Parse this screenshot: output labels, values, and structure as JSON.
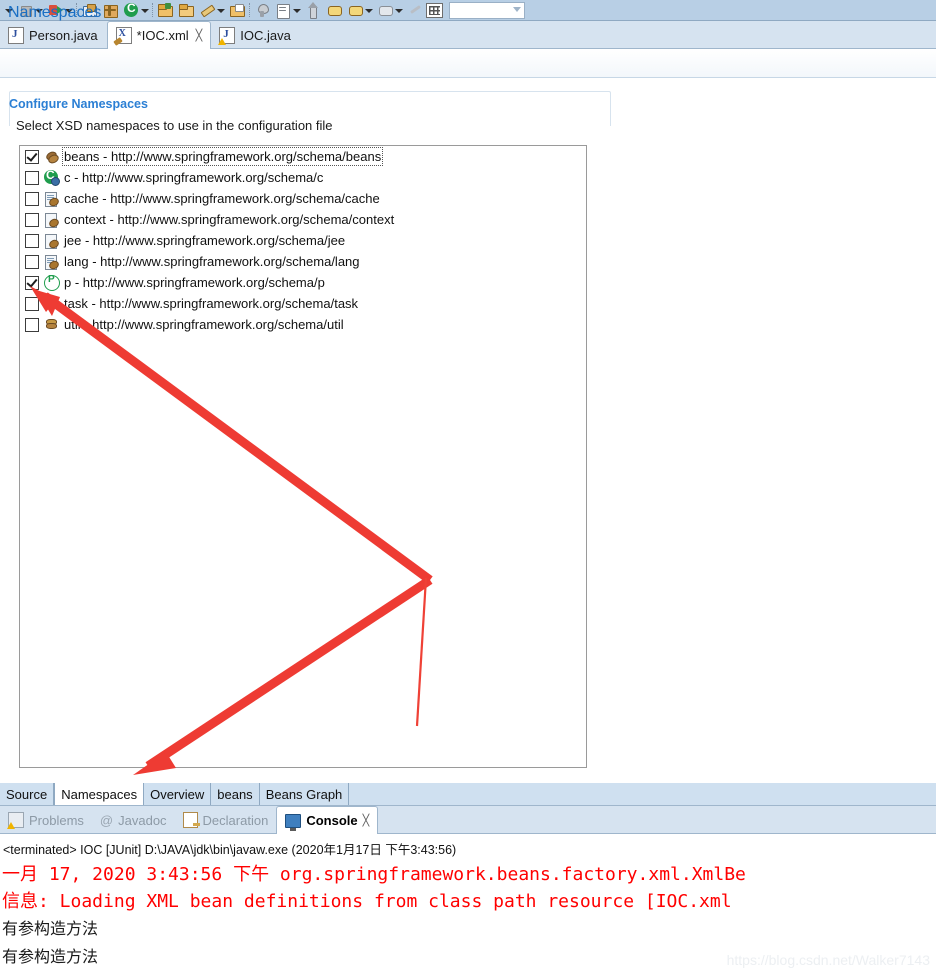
{
  "toolbar": {
    "icons": [
      {
        "name": "debug-dropdown-icon"
      },
      {
        "name": "stop-icon"
      },
      {
        "name": "run-icon"
      },
      {
        "name": "open-type-icon"
      },
      {
        "name": "package-icon"
      },
      {
        "name": "coverage-icon"
      },
      {
        "name": "new-folder-icon"
      },
      {
        "name": "open-folder-icon"
      },
      {
        "name": "pencil-icon"
      },
      {
        "name": "export-icon"
      },
      {
        "name": "search-icon"
      },
      {
        "name": "task-icon"
      },
      {
        "name": "next-annotation-icon"
      },
      {
        "name": "previous-edit-icon"
      },
      {
        "name": "bookmark-icon"
      },
      {
        "name": "back-icon"
      },
      {
        "name": "perspective-icon"
      }
    ],
    "combo_value": ""
  },
  "editor_tabs": [
    {
      "label": "Person.java",
      "icon": "java-file-icon",
      "active": false,
      "dirty": false,
      "closable": false
    },
    {
      "label": "*IOC.xml",
      "icon": "xml-file-icon",
      "active": true,
      "dirty": true,
      "closable": true,
      "close_glyph": "╳"
    },
    {
      "label": "IOC.java",
      "icon": "java-warning-file-icon",
      "active": false,
      "dirty": false,
      "closable": false
    }
  ],
  "form": {
    "title": "Namespaces",
    "section_title": "Configure Namespaces",
    "section_description": "Select XSD namespaces to use in the configuration file"
  },
  "namespaces": [
    {
      "checked": true,
      "icon": "bean-icon",
      "label": "beans - http://www.springframework.org/schema/beans",
      "focused": true
    },
    {
      "checked": false,
      "icon": "c-namespace-icon",
      "label": "c - http://www.springframework.org/schema/c",
      "focused": false
    },
    {
      "checked": false,
      "icon": "cache-icon",
      "label": "cache - http://www.springframework.org/schema/cache",
      "focused": false
    },
    {
      "checked": false,
      "icon": "context-icon",
      "label": "context - http://www.springframework.org/schema/context",
      "focused": false
    },
    {
      "checked": false,
      "icon": "jee-icon",
      "label": "jee - http://www.springframework.org/schema/jee",
      "focused": false
    },
    {
      "checked": false,
      "icon": "lang-icon",
      "label": "lang - http://www.springframework.org/schema/lang",
      "focused": false
    },
    {
      "checked": true,
      "icon": "p-namespace-icon",
      "label": "p - http://www.springframework.org/schema/p",
      "focused": false
    },
    {
      "checked": false,
      "icon": "task-icon",
      "label": "task - http://www.springframework.org/schema/task",
      "focused": false
    },
    {
      "checked": false,
      "icon": "util-icon",
      "label": "util - http://www.springframework.org/schema/util",
      "focused": false
    }
  ],
  "form_tabs": [
    {
      "label": "Source",
      "active": false
    },
    {
      "label": "Namespaces",
      "active": true
    },
    {
      "label": "Overview",
      "active": false
    },
    {
      "label": "beans",
      "active": false
    },
    {
      "label": "Beans Graph",
      "active": false
    }
  ],
  "view_tabs": [
    {
      "label": "Problems",
      "icon": "problems-icon",
      "active": false,
      "closable": false
    },
    {
      "label": "Javadoc",
      "icon": "javadoc-icon",
      "active": false,
      "closable": false
    },
    {
      "label": "Declaration",
      "icon": "declaration-icon",
      "active": false,
      "closable": false
    },
    {
      "label": "Console",
      "icon": "console-icon",
      "active": true,
      "closable": true,
      "close_glyph": "╳"
    }
  ],
  "console": {
    "header": "<terminated> IOC [JUnit] D:\\JAVA\\jdk\\bin\\javaw.exe (2020年1月17日 下午3:43:56)",
    "lines": [
      {
        "text": "一月 17, 2020 3:43:56 下午 org.springframework.beans.factory.xml.XmlBe",
        "color": "#ff0000",
        "style": "mono"
      },
      {
        "text": "信息: Loading XML bean definitions from class path resource [IOC.xml",
        "color": "#ff0000",
        "style": "mono"
      },
      {
        "text": "有参构造方法",
        "color": "#1a1a1a",
        "style": "sans"
      },
      {
        "text": "有参构造方法",
        "color": "#1a1a1a",
        "style": "sans"
      }
    ]
  },
  "annotations": {
    "watermark": "https://blog.csdn.net/Walker7143",
    "arrow_color": "#ee3b33",
    "thin_line_color": "#ef4136"
  },
  "colors": {
    "toolbar_bg": "#b8cfe5",
    "tab_bg": "#d6e3f0",
    "accent_blue": "#1a6fc4",
    "section_blue": "#2b7fd4"
  }
}
